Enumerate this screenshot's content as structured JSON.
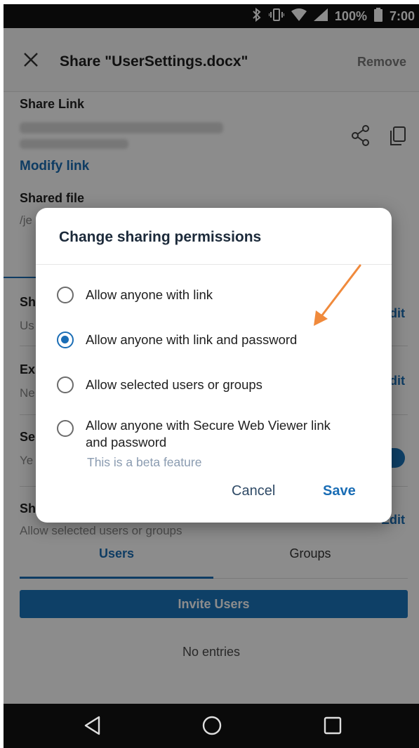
{
  "status_bar": {
    "battery": "100%",
    "time": "7:00"
  },
  "app_bar": {
    "title": "Share \"UserSettings.docx\"",
    "remove_label": "Remove"
  },
  "content": {
    "share_link_label": "Share Link",
    "modify_link_label": "Modify link",
    "shared_file_label": "Shared file",
    "shared_file_path": "/je",
    "rows": [
      {
        "partial_title": "Sh",
        "partial_sub": "Us",
        "action": "dit"
      },
      {
        "partial_title": "Ex",
        "partial_sub": "Ne",
        "action": "dit"
      },
      {
        "partial_title": "Se",
        "partial_sub": "Ye"
      },
      {
        "partial_title": "Sh",
        "sub": "Allow selected users or groups",
        "action": "Edit"
      }
    ],
    "tabs": [
      "Users",
      "Groups"
    ],
    "invite_button": "Invite Users",
    "empty_text": "No entries"
  },
  "dialog": {
    "title": "Change sharing permissions",
    "options": [
      {
        "label": "Allow anyone with link",
        "selected": false
      },
      {
        "label": "Allow anyone with link and password",
        "selected": true
      },
      {
        "label": "Allow selected users or groups",
        "selected": false
      },
      {
        "label": "Allow anyone with Secure Web Viewer link and password",
        "selected": false
      }
    ],
    "beta_note": "This is a beta feature",
    "cancel_label": "Cancel",
    "save_label": "Save"
  },
  "colors": {
    "accent": "#1a6db5",
    "annotation_arrow": "#f08a3c"
  },
  "icons": [
    "bluetooth-icon",
    "vibrate-icon",
    "wifi-icon",
    "signal-icon",
    "battery-icon",
    "close-icon",
    "share-icon",
    "copy-icon",
    "back-icon",
    "home-icon",
    "recents-icon"
  ]
}
